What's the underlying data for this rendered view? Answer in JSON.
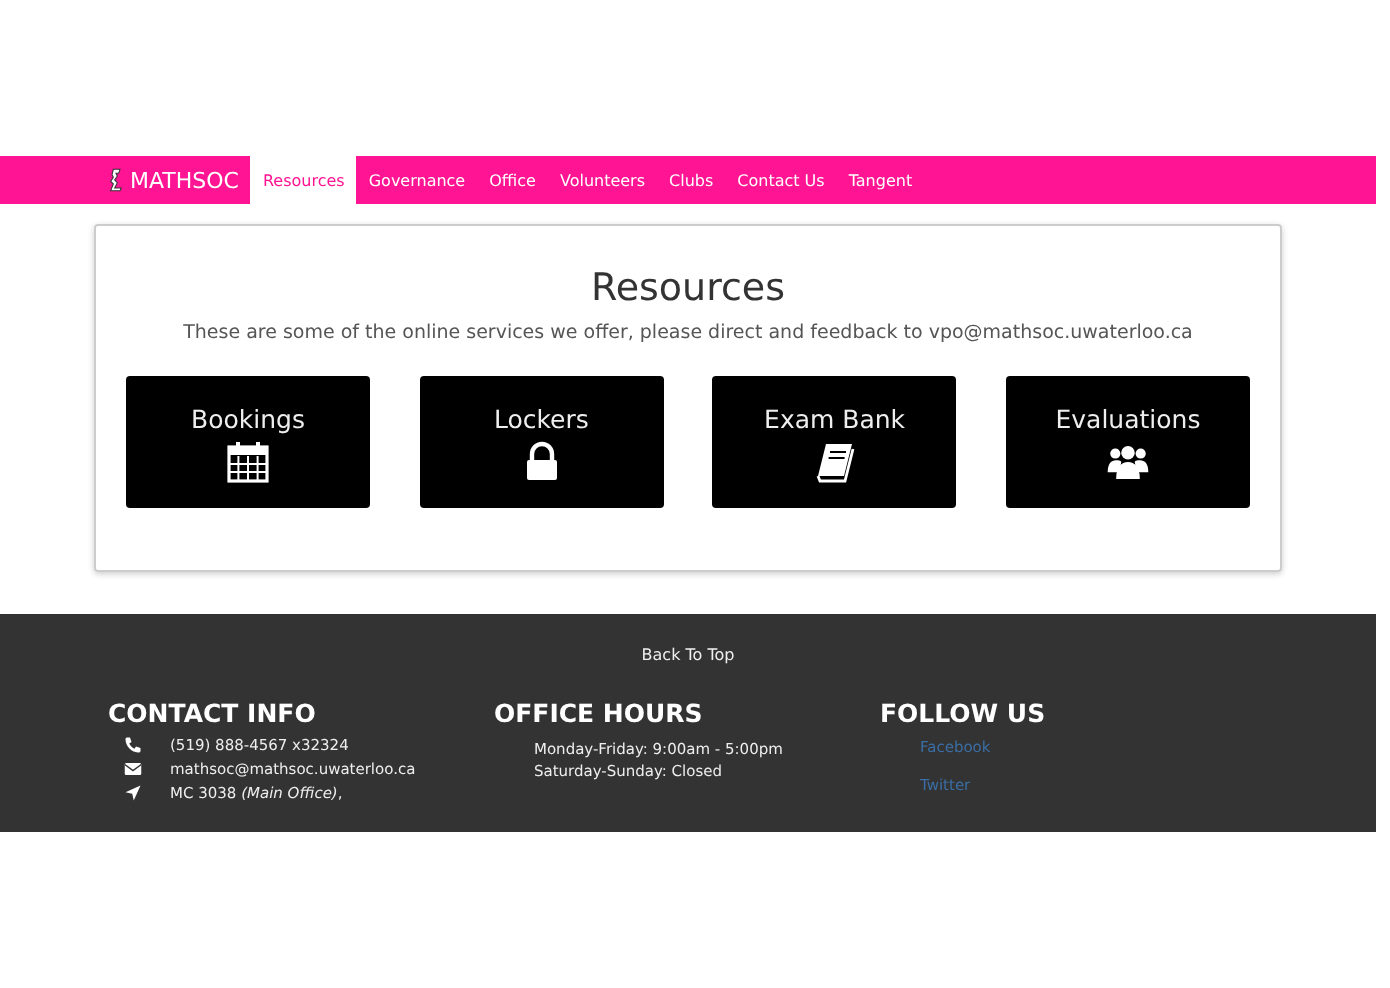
{
  "nav": {
    "brand": "MATHSOC",
    "tabs": [
      {
        "label": "Resources",
        "selected": true
      },
      {
        "label": "Governance",
        "selected": false
      },
      {
        "label": "Office",
        "selected": false
      },
      {
        "label": "Volunteers",
        "selected": false
      },
      {
        "label": "Clubs",
        "selected": false
      },
      {
        "label": "Contact Us",
        "selected": false
      },
      {
        "label": "Tangent",
        "selected": false
      }
    ]
  },
  "panel": {
    "title": "Resources",
    "subtitle": "These are some of the online services we offer, please direct and feedback to vpo@mathsoc.uwaterloo.ca",
    "tiles": [
      {
        "label": "Bookings",
        "kind": "calendar"
      },
      {
        "label": "Lockers",
        "kind": "lock"
      },
      {
        "label": "Exam Bank",
        "kind": "book"
      },
      {
        "label": "Evaluations",
        "kind": "people"
      }
    ]
  },
  "footer": {
    "back_to_top": "Back To Top",
    "contact": {
      "heading": "CONTACT INFO",
      "items": [
        {
          "kind": "phone",
          "text": "(519) 888-4567 x32324"
        },
        {
          "kind": "mail",
          "text": "mathsoc@mathsoc.uwaterloo.ca"
        },
        {
          "kind": "location",
          "text": "MC 3038 *(Main Office)*,"
        }
      ]
    },
    "hours": {
      "heading": "OFFICE HOURS",
      "lines": [
        "Monday-Friday: 9:00am - 5:00pm",
        "Saturday-Sunday: Closed"
      ]
    },
    "follow": {
      "heading": "FOLLOW US",
      "links": [
        "Facebook",
        "Twitter"
      ]
    }
  }
}
